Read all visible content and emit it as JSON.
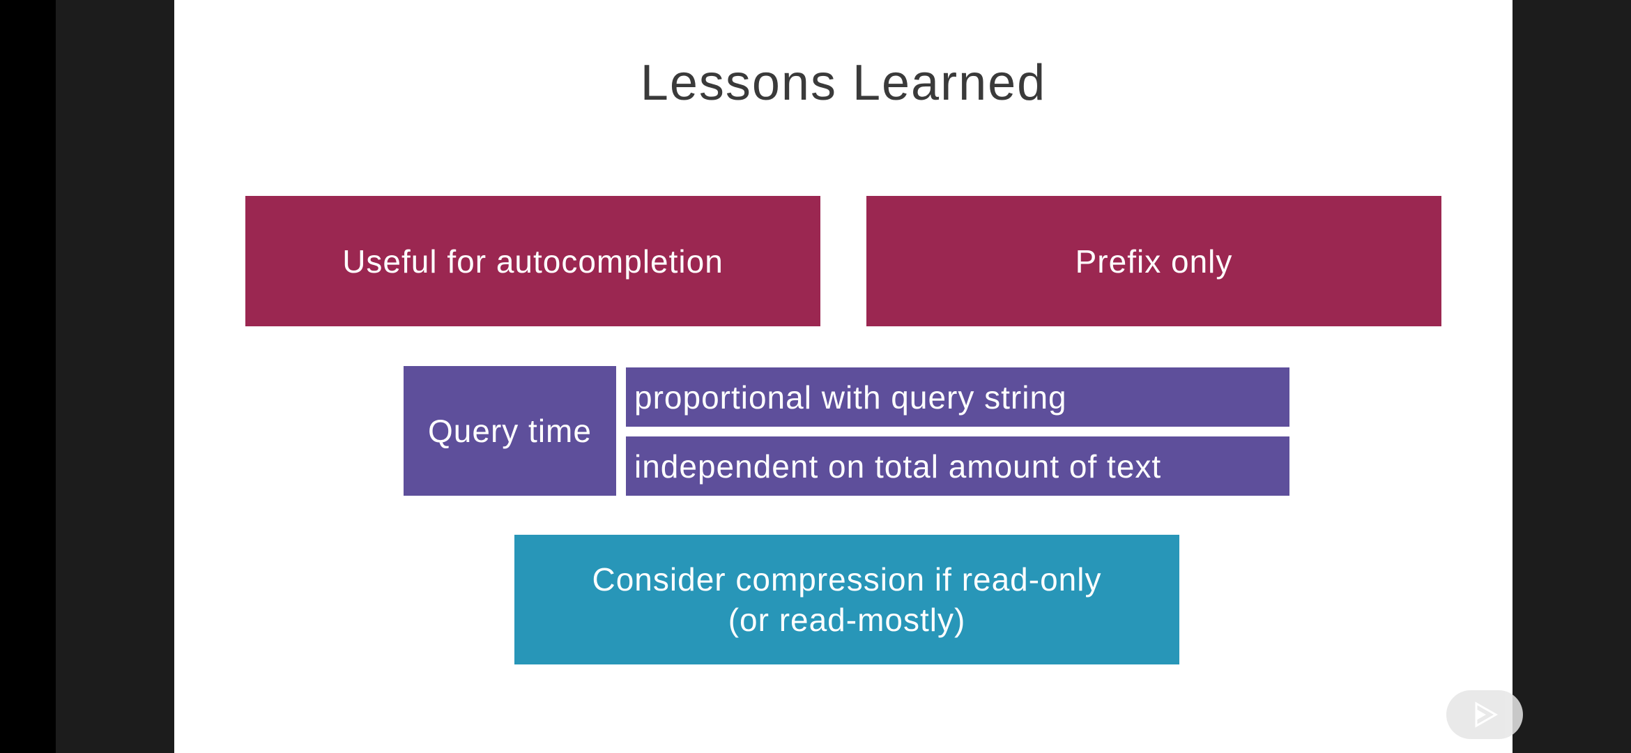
{
  "slide": {
    "title": "Lessons Learned",
    "box_autocompletion": "Useful for autocompletion",
    "box_prefix": "Prefix only",
    "box_query_time": "Query time",
    "box_proportional": "proportional with query string",
    "box_independent": "independent on total amount of text",
    "box_compression_line1": "Consider compression if read-only",
    "box_compression_line2": "(or read-mostly)"
  },
  "colors": {
    "magenta": "#9b2751",
    "purple": "#5e4f9b",
    "teal": "#2896b8",
    "title_text": "#3a3a3a"
  },
  "icons": {
    "play": "play-icon"
  }
}
